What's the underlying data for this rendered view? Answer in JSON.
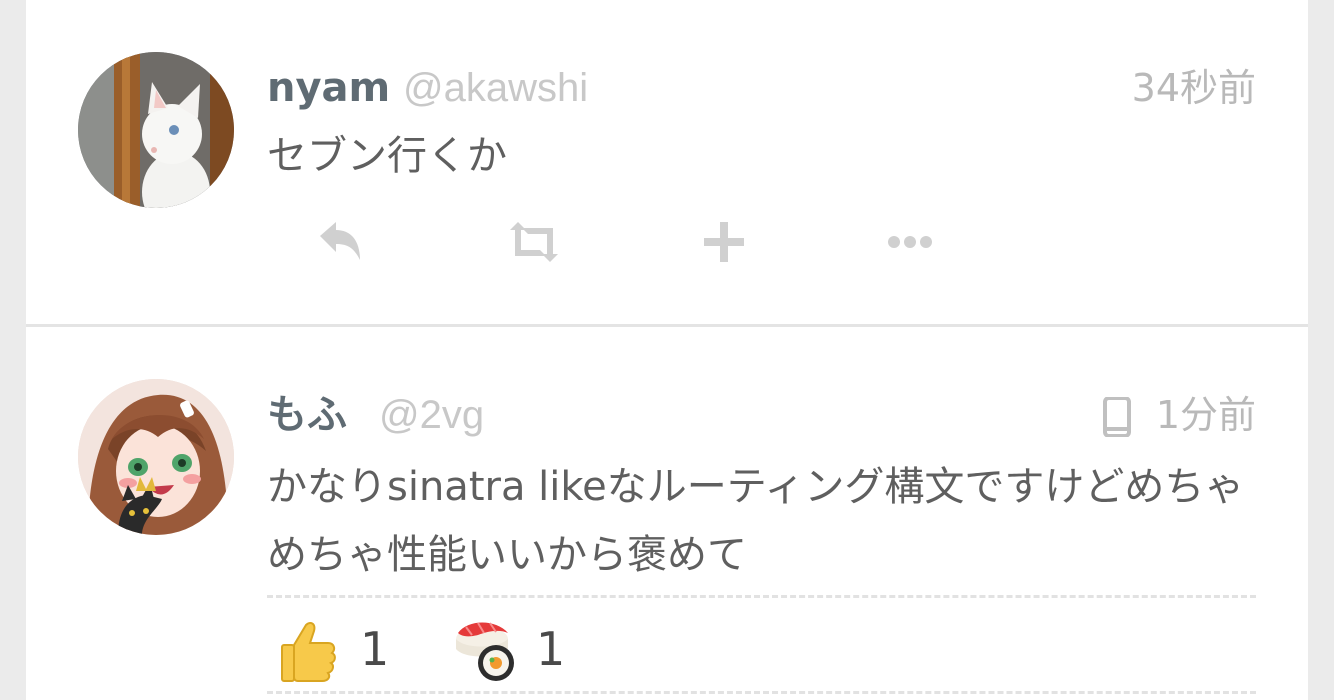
{
  "posts": [
    {
      "name": "nyam",
      "handle": "@akawshi",
      "time": "34秒前",
      "text": "セブン行くか",
      "actions": [
        "reply-icon",
        "repost-icon",
        "add-reaction-icon",
        "more-icon"
      ]
    },
    {
      "name": "もふ",
      "handle": "@2vg",
      "time": "1分前",
      "device_icon": "mobile-phone-icon",
      "text": "かなりsinatra likeなルーティング構文ですけどめちゃめちゃ性能いいから褒めて",
      "reactions": [
        {
          "icon": "thumbs-up-icon",
          "count": "1"
        },
        {
          "icon": "sushi-icon",
          "count": "1"
        }
      ]
    }
  ],
  "colors": {
    "background": "#ebebeb",
    "card": "#ffffff",
    "name": "#5f6b73",
    "muted": "#c8c8c8",
    "icon": "#d0d0d0"
  }
}
